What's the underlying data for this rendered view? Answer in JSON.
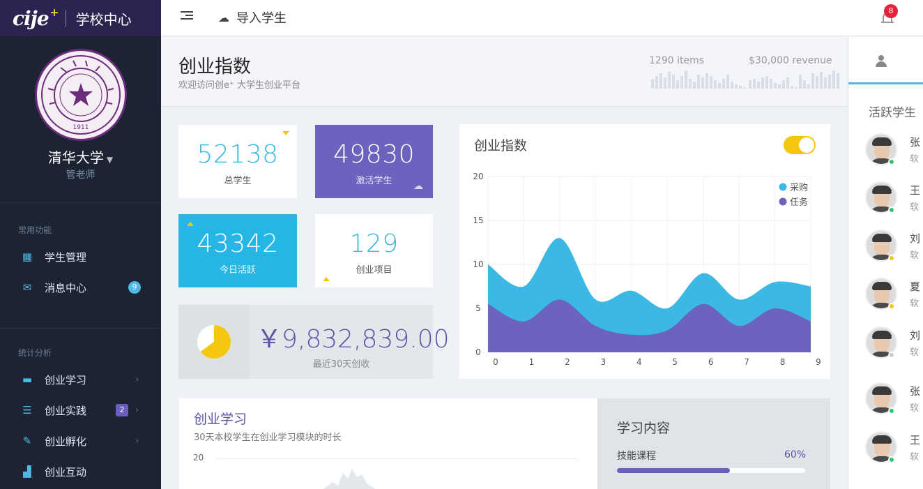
{
  "brand": {
    "logo": "cije",
    "logo_mark": "+",
    "title": "学校中心"
  },
  "school": {
    "name": "清华大学",
    "role": "管老师",
    "seal_text": "1911"
  },
  "nav": {
    "sections": [
      {
        "heading": "常用功能",
        "items": [
          {
            "label": "学生管理",
            "icon": "calendar-icon"
          },
          {
            "label": "消息中心",
            "icon": "envelope-icon",
            "badge": "9"
          }
        ]
      },
      {
        "heading": "统计分析",
        "items": [
          {
            "label": "创业学习",
            "icon": "briefcase-icon"
          },
          {
            "label": "创业实践",
            "icon": "list-icon",
            "badge": "2"
          },
          {
            "label": "创业孵化",
            "icon": "edit-icon"
          },
          {
            "label": "创业互动",
            "icon": "signal-icon"
          }
        ]
      }
    ]
  },
  "topbar": {
    "import_label": "导入学生",
    "notification_count": "8"
  },
  "header": {
    "title": "创业指数",
    "subtitle": "欢迎访问创e⁺ 大学生创业平台",
    "items_stat": "1290 items",
    "revenue_stat": "$30,000 revenue"
  },
  "stats": {
    "total_students": {
      "value": "52138",
      "label": "总学生"
    },
    "active_students": {
      "value": "49830",
      "label": "激活学生"
    },
    "today_active": {
      "value": "43342",
      "label": "今日活跃"
    },
    "projects": {
      "value": "129",
      "label": "创业项目"
    }
  },
  "revenue": {
    "amount": "￥9,832,839.00",
    "label": "最近30天创收",
    "pie_fraction": 0.65
  },
  "chart_data": {
    "type": "area",
    "title": "创业指数",
    "x": [
      0,
      1,
      2,
      3,
      4,
      5,
      6,
      7,
      8,
      9
    ],
    "ylim": [
      0,
      20
    ],
    "yticks": [
      0,
      5,
      10,
      15,
      20
    ],
    "grid": true,
    "legend_position": "top-right",
    "series": [
      {
        "name": "采购",
        "color": "#3bb8e3",
        "values": [
          10,
          7.5,
          13,
          6,
          7,
          5,
          9,
          6,
          8,
          7.5
        ]
      },
      {
        "name": "任务",
        "color": "#6b63bd",
        "values": [
          5.5,
          3.5,
          6,
          3,
          2,
          2.5,
          5.5,
          3,
          5,
          3.5
        ]
      }
    ]
  },
  "learning": {
    "title": "创业学习",
    "subtitle": "30天本校学生在创业学习模块的时长",
    "axis_top": "20"
  },
  "content": {
    "title": "学习内容",
    "item": "技能课程",
    "percent": "60%",
    "progress": 0.6
  },
  "right_panel": {
    "title": "活跃学生",
    "users": [
      {
        "name": "张",
        "dept": "软",
        "status": "#2ec46b"
      },
      {
        "name": "王",
        "dept": "软",
        "status": "#2ec46b"
      },
      {
        "name": "刘",
        "dept": "软",
        "status": "#f6c710"
      },
      {
        "name": "夏",
        "dept": "软",
        "status": "#f6c710"
      },
      {
        "name": "刘",
        "dept": "软",
        "status": "#cccccc"
      },
      {
        "name": "张",
        "dept": "软",
        "status": "#2ec46b"
      },
      {
        "name": "王",
        "dept": "软",
        "status": "#2ec46b"
      }
    ]
  }
}
